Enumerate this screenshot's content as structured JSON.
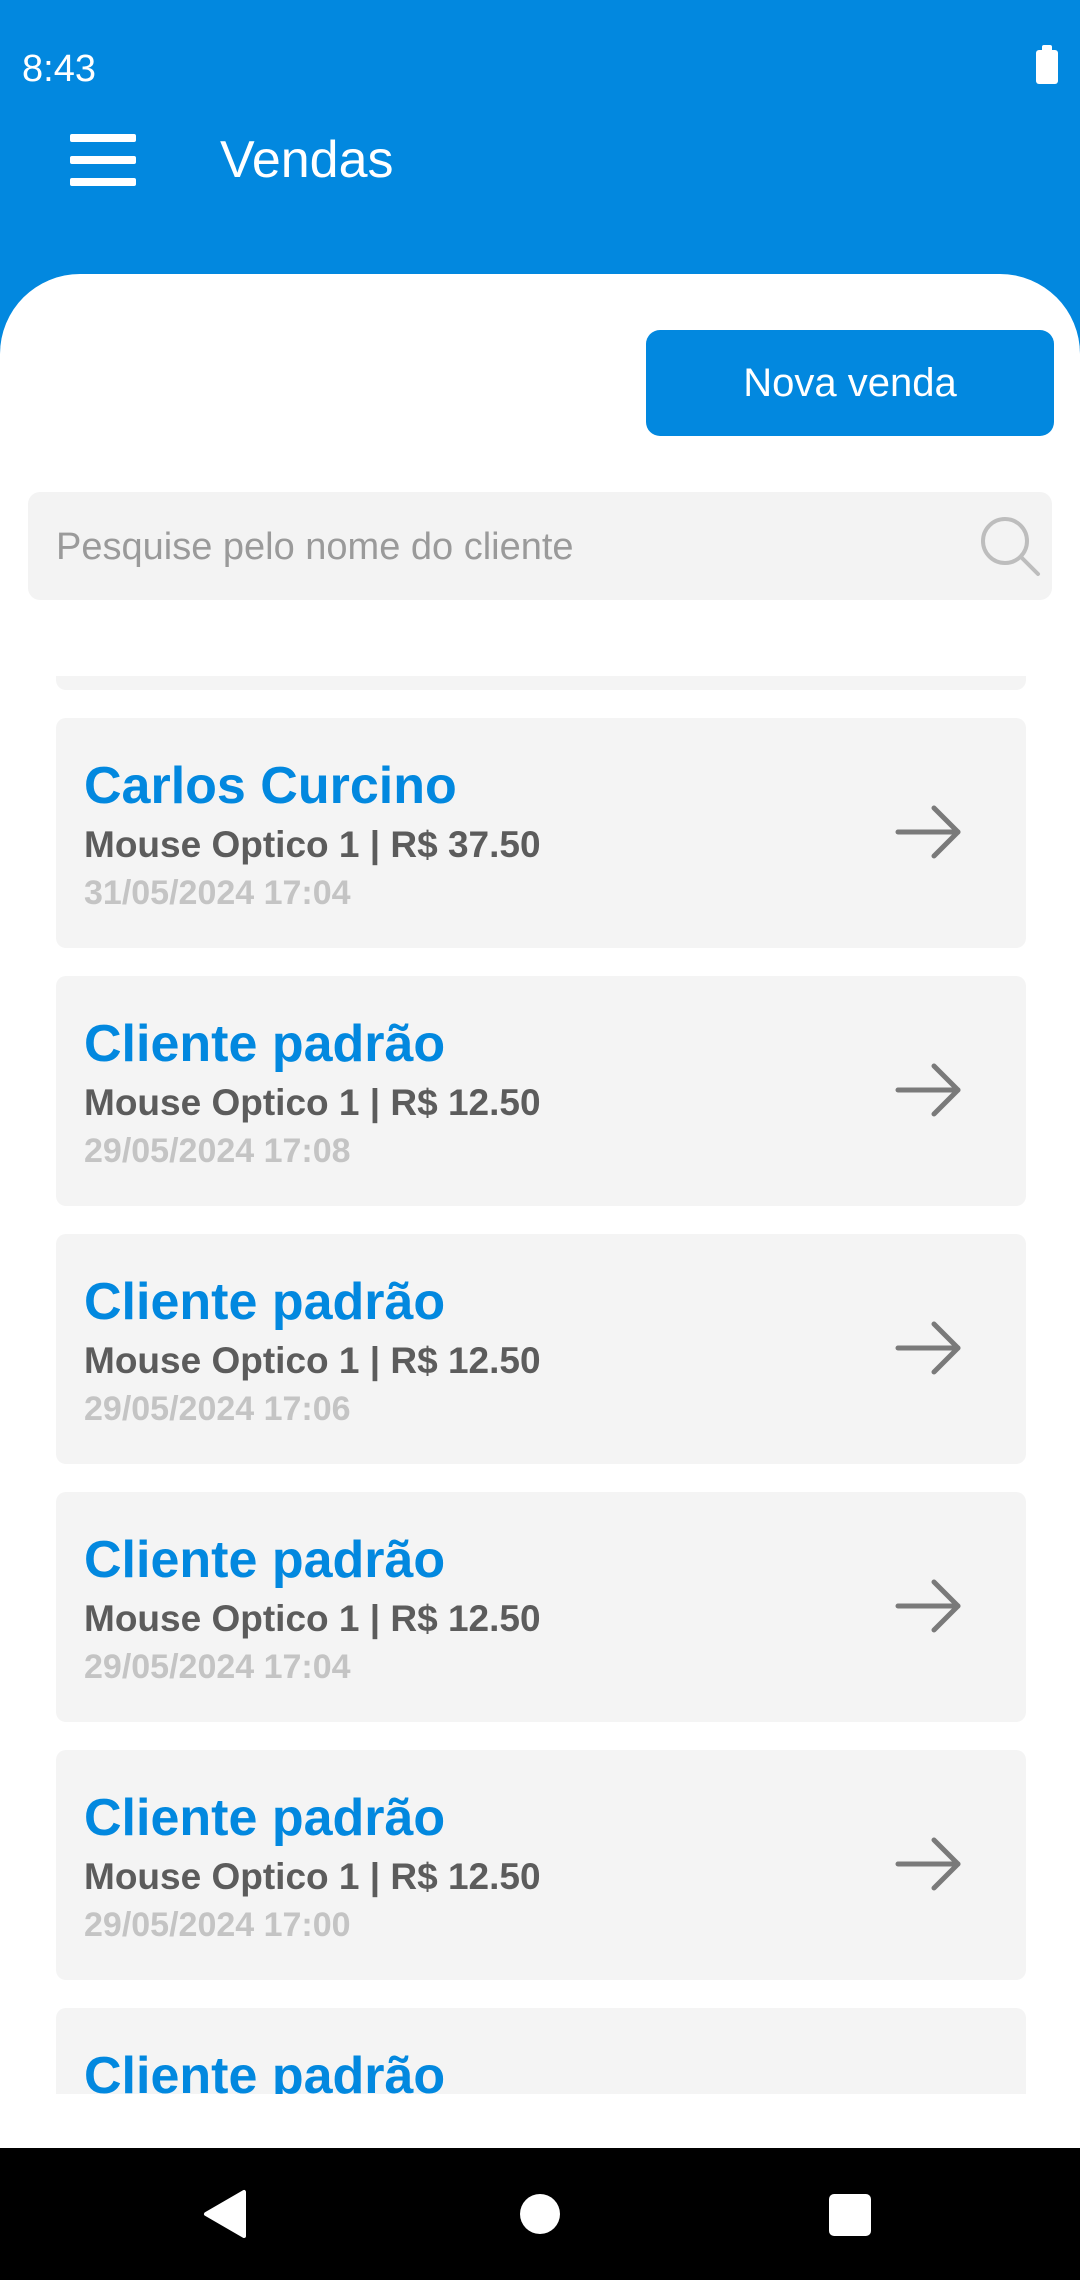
{
  "status_bar": {
    "time": "8:43",
    "battery_icon": "battery-full-icon"
  },
  "app_bar": {
    "menu_icon": "menu-icon",
    "title": "Vendas"
  },
  "actions": {
    "new_sale_label": "Nova venda"
  },
  "search": {
    "placeholder": "Pesquise pelo nome do cliente",
    "value": "",
    "icon": "search-icon"
  },
  "sales": [
    {
      "client": "Carlos Curcino",
      "summary": "Mouse Optico 1 | R$ 37.50",
      "date": "31/05/2024 17:04"
    },
    {
      "client": "Cliente padrão",
      "summary": "Mouse Optico 1 | R$ 12.50",
      "date": "29/05/2024 17:08"
    },
    {
      "client": "Cliente padrão",
      "summary": "Mouse Optico 1 | R$ 12.50",
      "date": "29/05/2024 17:06"
    },
    {
      "client": "Cliente padrão",
      "summary": "Mouse Optico 1 | R$ 12.50",
      "date": "29/05/2024 17:04"
    },
    {
      "client": "Cliente padrão",
      "summary": "Mouse Optico 1 | R$ 12.50",
      "date": "29/05/2024 17:00"
    },
    {
      "client": "Cliente padrão"
    }
  ],
  "colors": {
    "primary": "#0288DF",
    "card_bg": "#F4F4F4",
    "muted_text": "#5C5C5C",
    "date_text": "#C4C4C4"
  },
  "nav_bar": {
    "back_icon": "back-icon",
    "home_icon": "home-icon",
    "recents_icon": "recents-icon"
  }
}
